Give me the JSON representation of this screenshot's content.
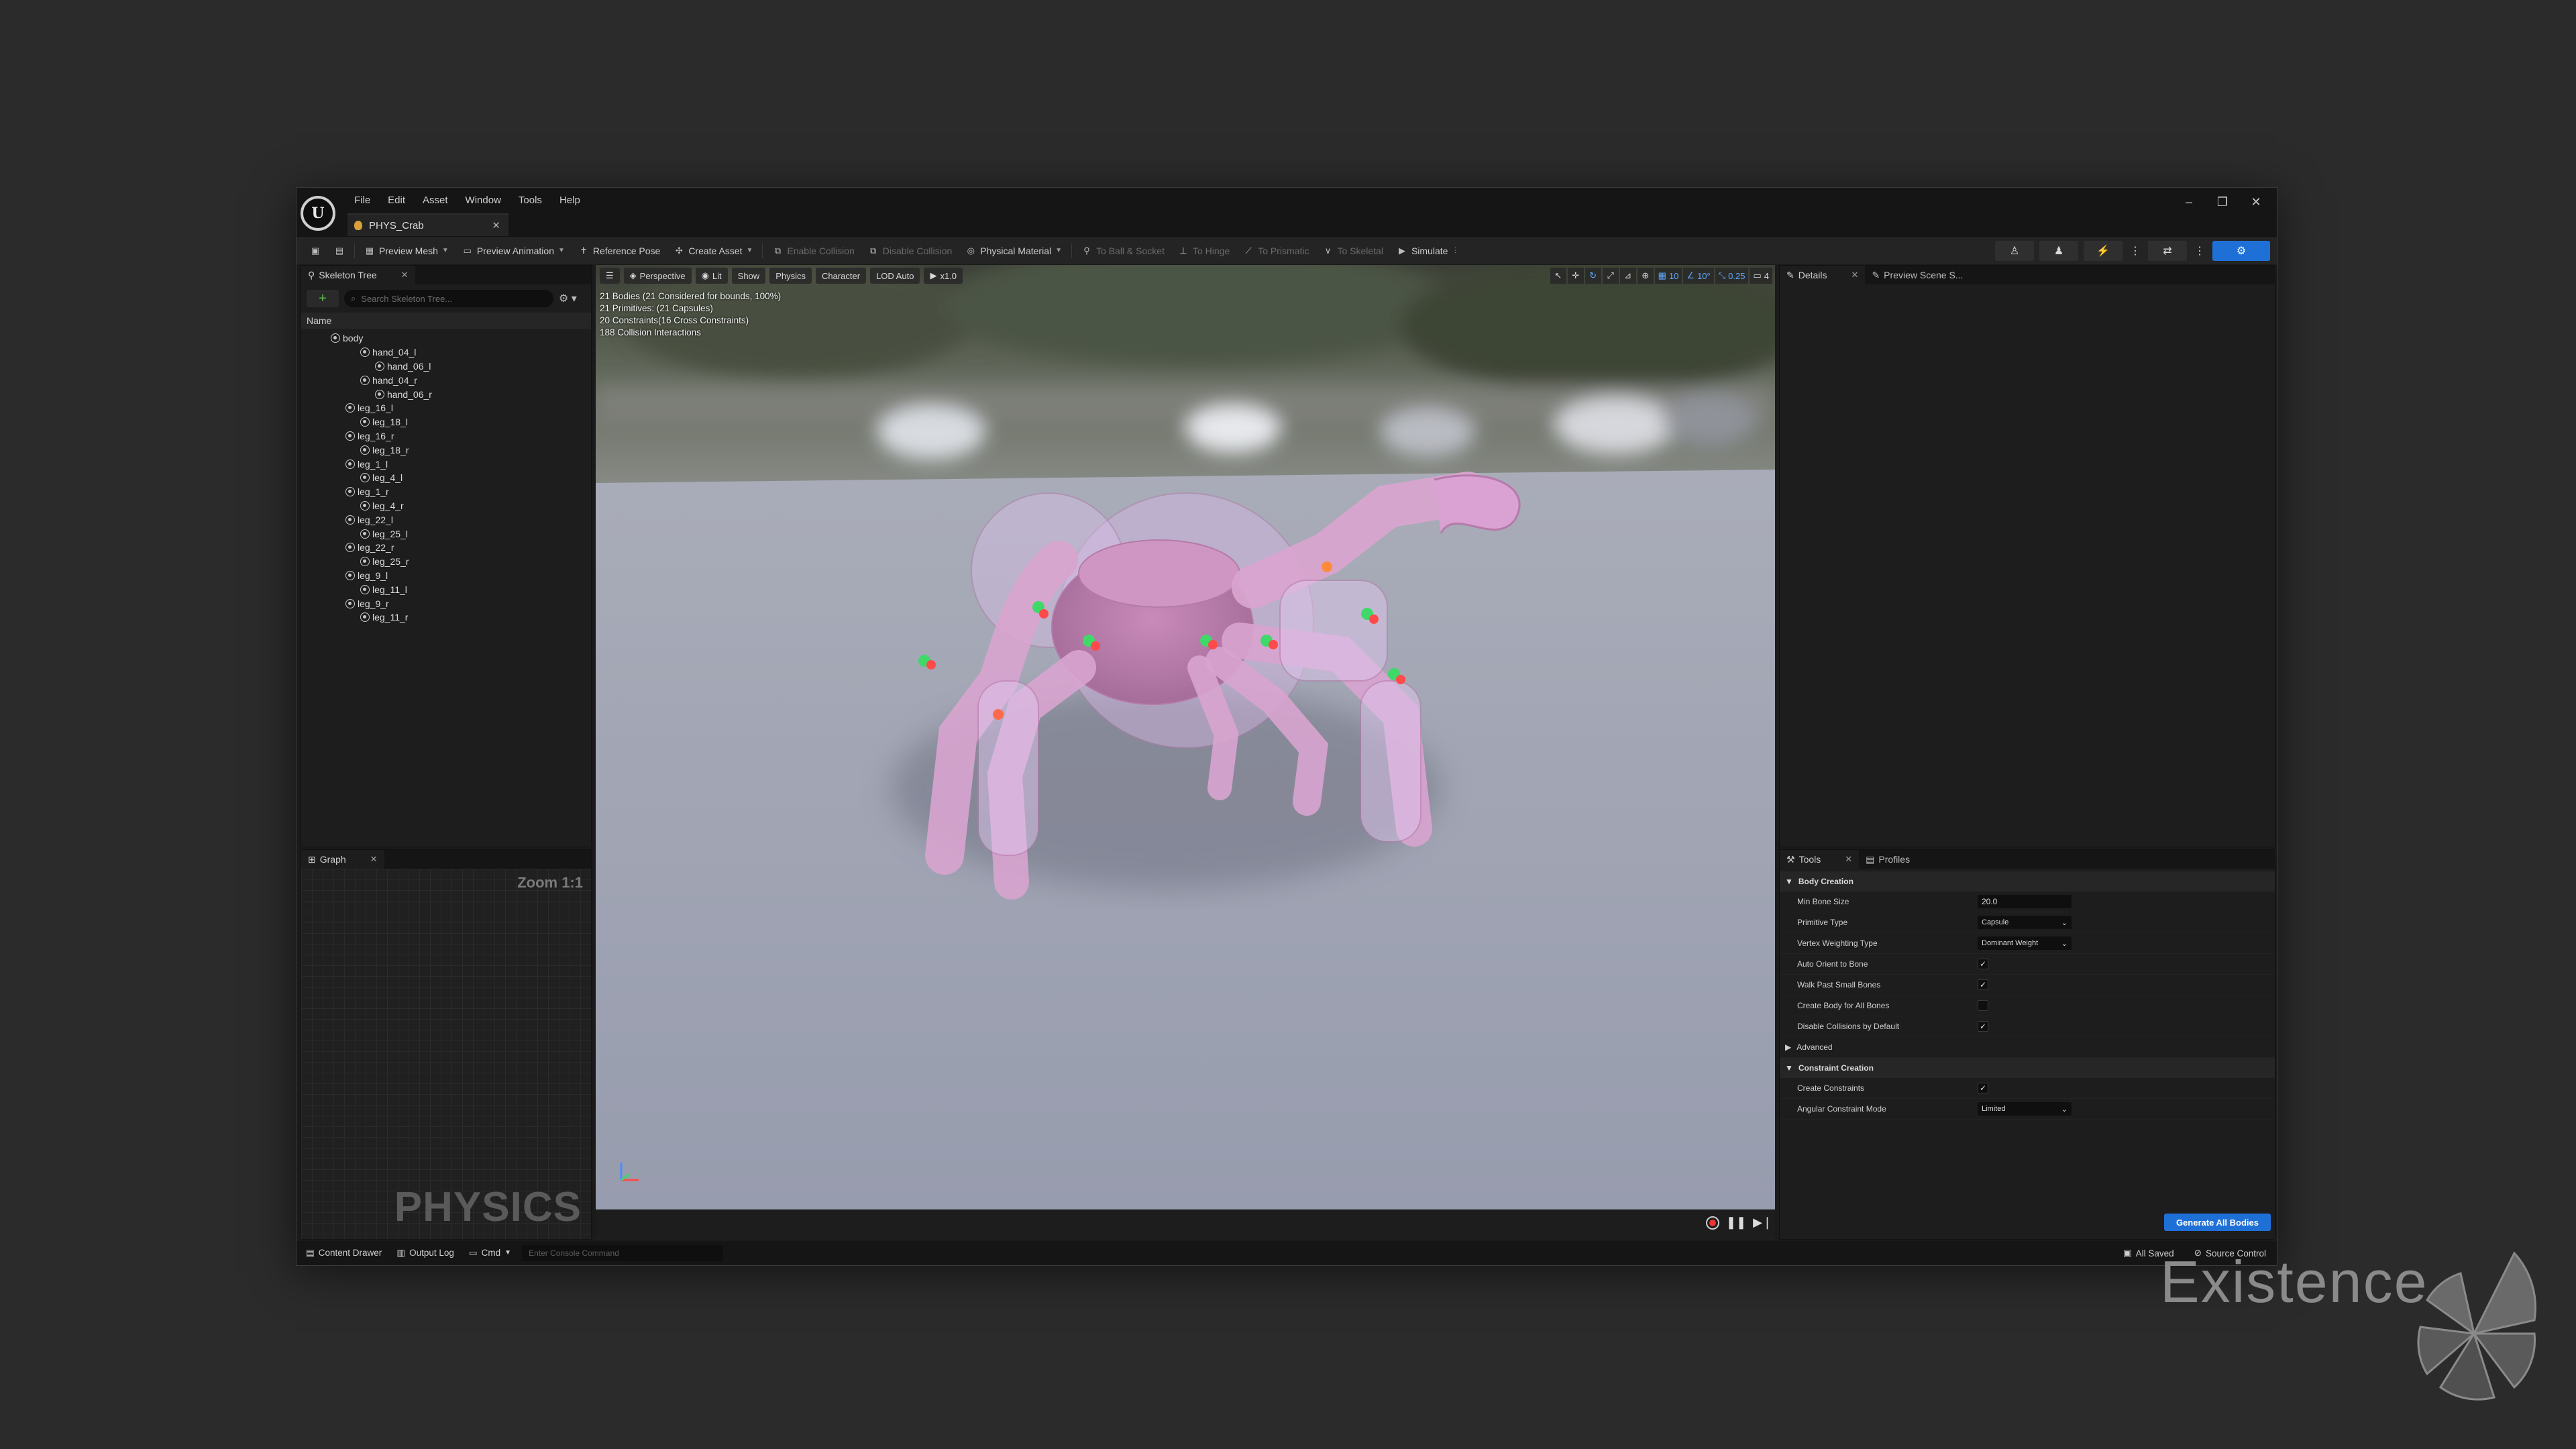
{
  "menu": [
    "File",
    "Edit",
    "Asset",
    "Window",
    "Tools",
    "Help"
  ],
  "logo_text": "U",
  "document_tab": {
    "label": "PHYS_Crab"
  },
  "toolbar": {
    "preview_mesh": "Preview Mesh",
    "preview_animation": "Preview Animation",
    "reference_pose": "Reference Pose",
    "create_asset": "Create Asset",
    "enable_collision": "Enable Collision",
    "disable_collision": "Disable Collision",
    "physical_material": "Physical Material",
    "to_ball_socket": "To Ball & Socket",
    "to_hinge": "To Hinge",
    "to_prismatic": "To Prismatic",
    "to_skeletal": "To Skeletal",
    "simulate": "Simulate"
  },
  "skeleton_panel": {
    "tab": "Skeleton Tree",
    "search_placeholder": "Search Skeleton Tree...",
    "column": "Name",
    "bones": [
      {
        "name": "body",
        "depth": 0
      },
      {
        "name": "hand_04_l",
        "depth": 2
      },
      {
        "name": "hand_06_l",
        "depth": 3
      },
      {
        "name": "hand_04_r",
        "depth": 2
      },
      {
        "name": "hand_06_r",
        "depth": 3
      },
      {
        "name": "leg_16_l",
        "depth": 1
      },
      {
        "name": "leg_18_l",
        "depth": 2
      },
      {
        "name": "leg_16_r",
        "depth": 1
      },
      {
        "name": "leg_18_r",
        "depth": 2
      },
      {
        "name": "leg_1_l",
        "depth": 1
      },
      {
        "name": "leg_4_l",
        "depth": 2
      },
      {
        "name": "leg_1_r",
        "depth": 1
      },
      {
        "name": "leg_4_r",
        "depth": 2
      },
      {
        "name": "leg_22_l",
        "depth": 1
      },
      {
        "name": "leg_25_l",
        "depth": 2
      },
      {
        "name": "leg_22_r",
        "depth": 1
      },
      {
        "name": "leg_25_r",
        "depth": 2
      },
      {
        "name": "leg_9_l",
        "depth": 1
      },
      {
        "name": "leg_11_l",
        "depth": 2
      },
      {
        "name": "leg_9_r",
        "depth": 1
      },
      {
        "name": "leg_11_r",
        "depth": 2
      }
    ]
  },
  "graph_panel": {
    "tab": "Graph",
    "zoom": "Zoom 1:1",
    "watermark": "PHYSICS"
  },
  "viewport": {
    "buttons": {
      "perspective": "Perspective",
      "lit": "Lit",
      "show": "Show",
      "physics": "Physics",
      "character": "Character",
      "lod": "LOD Auto",
      "speed": "x1.0"
    },
    "right": {
      "grid": "10",
      "angle": "10°",
      "scale": "0.25",
      "camera": "4"
    },
    "stats": [
      "21 Bodies (21 Considered for bounds, 100%)",
      "21 Primitives: (21 Capsules)",
      "20 Constraints(16 Cross Constraints)",
      "188 Collision Interactions"
    ]
  },
  "details_panel": {
    "tab": "Details",
    "tab2": "Preview Scene S..."
  },
  "tools_panel": {
    "tab": "Tools",
    "tab2": "Profiles",
    "body_creation": "Body Creation",
    "min_bone_size": {
      "label": "Min Bone Size",
      "value": "20.0"
    },
    "primitive_type": {
      "label": "Primitive Type",
      "value": "Capsule"
    },
    "vertex_weighting": {
      "label": "Vertex Weighting Type",
      "value": "Dominant Weight"
    },
    "auto_orient": {
      "label": "Auto Orient to Bone",
      "checked": true
    },
    "walk_past": {
      "label": "Walk Past Small Bones",
      "checked": true
    },
    "create_body_all": {
      "label": "Create Body for All Bones",
      "checked": false
    },
    "disable_collisions": {
      "label": "Disable Collisions by Default",
      "checked": true
    },
    "advanced": "Advanced",
    "constraint_creation": "Constraint Creation",
    "create_constraints": {
      "label": "Create Constraints",
      "checked": true
    },
    "angular_mode": {
      "label": "Angular Constraint Mode",
      "value": "Limited"
    },
    "generate_button": "Generate All Bodies"
  },
  "statusbar": {
    "content_drawer": "Content Drawer",
    "output_log": "Output Log",
    "cmd": "Cmd",
    "console_placeholder": "Enter Console Command",
    "all_saved": "All Saved",
    "source_control": "Source Control"
  },
  "watermark": "Existence",
  "colors": {
    "accent": "#1f70d6",
    "crab": "#d79ad0",
    "floor": "#9ea3b3"
  }
}
